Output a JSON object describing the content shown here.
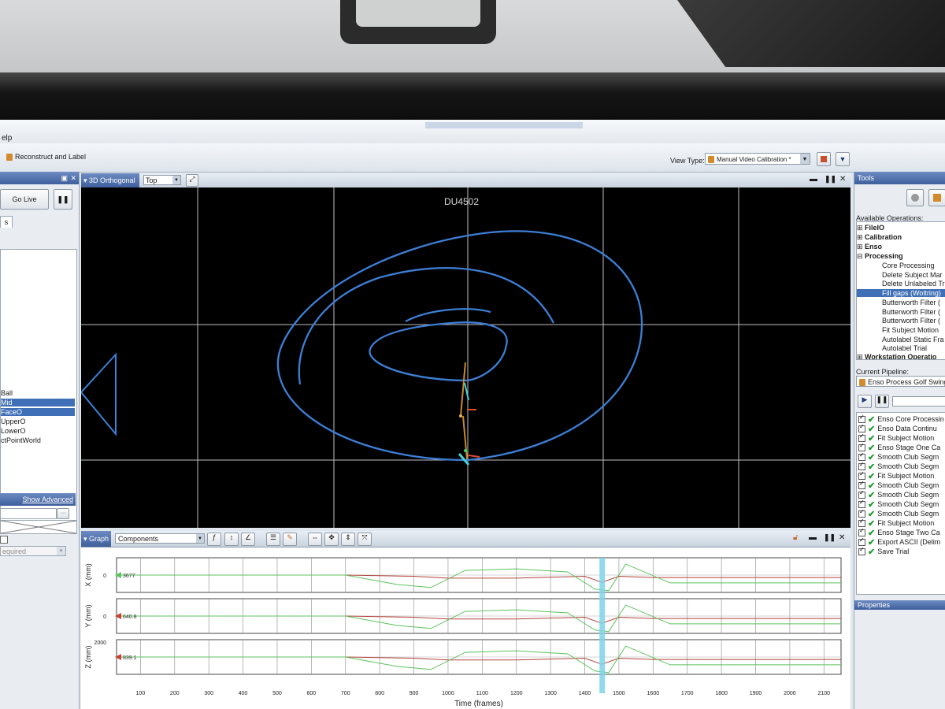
{
  "menu": {
    "help_fragment": "elp"
  },
  "toolbar": {
    "reconstruct_label": "Reconstruct and Label",
    "view_type_label": "View Type:",
    "view_type_value": "Manual Video Calibration *"
  },
  "left_panel": {
    "go_live": "Go Live",
    "tab_fragment": "s",
    "items": [
      "Ball",
      "Mid",
      "FaceO",
      "UpperO",
      "LowerO",
      "ctPointWorld"
    ],
    "selected_items": [
      "Mid",
      "FaceO"
    ],
    "show_advanced": "Show Advanced",
    "required_placeholder": "equired"
  },
  "viewport": {
    "view_name": "3D Orthogonal",
    "projection": "Top",
    "camera_label": "DU4502"
  },
  "graph": {
    "tab": "Graph",
    "mode": "Components",
    "x_label": "Time (frames)",
    "x_ticks": [
      "100",
      "200",
      "300",
      "400",
      "500",
      "600",
      "700",
      "800",
      "900",
      "1000",
      "1100",
      "1200",
      "1300",
      "1400",
      "1500",
      "1600",
      "1700",
      "1800",
      "1900",
      "2000",
      "2100"
    ],
    "panels": [
      {
        "ylabel": "X (mm)",
        "tick": "0",
        "readout": "3677"
      },
      {
        "ylabel": "Y (mm)",
        "tick": "0",
        "readout": "640.8"
      },
      {
        "ylabel": "Z (mm)",
        "tick": "2000",
        "readout": "839.1"
      }
    ],
    "cursor_frame": 1450
  },
  "right_panel": {
    "title": "Tools",
    "available_ops_label": "Available Operations:",
    "groups": [
      "FileIO",
      "Calibration",
      "Enso",
      "Processing"
    ],
    "processing_ops": [
      "Core Processing",
      "Delete Subject Mar",
      "Delete Unlabeled Tr",
      "Fill gaps (Woltring)",
      "Butterworth Filter (",
      "Butterworth Filter (",
      "Butterworth Filter (",
      "Fit Subject Motion",
      "Autolabel Static Fra",
      "Autolabel Trial"
    ],
    "selected_op": "Fill gaps (Woltring)",
    "workstation_group": "Workstation Operatio",
    "current_pipeline_label": "Current Pipeline:",
    "pipeline_name": "Enso Process Golf Swing *",
    "pipeline_steps": [
      "Enso Core Processin",
      "Enso Data Continu",
      "Fit Subject Motion",
      "Enso Stage One Ca",
      "Smooth Club Segm",
      "Smooth Club Segm",
      "Fit Subject Motion",
      "Smooth Club Segm",
      "Smooth Club Segm",
      "Smooth Club Segm",
      "Smooth Club Segm",
      "Fit Subject Motion",
      "Enso Stage Two Ca",
      "Export ASCII (Delim",
      "Save Trial"
    ],
    "properties_label": "Properties"
  },
  "colors": {
    "accent": "#3f6fb6",
    "trajectory": "#3d7fd6",
    "series_red": "#b2423a",
    "series_green": "#5cc35c",
    "cursor": "#7cd4e8"
  }
}
